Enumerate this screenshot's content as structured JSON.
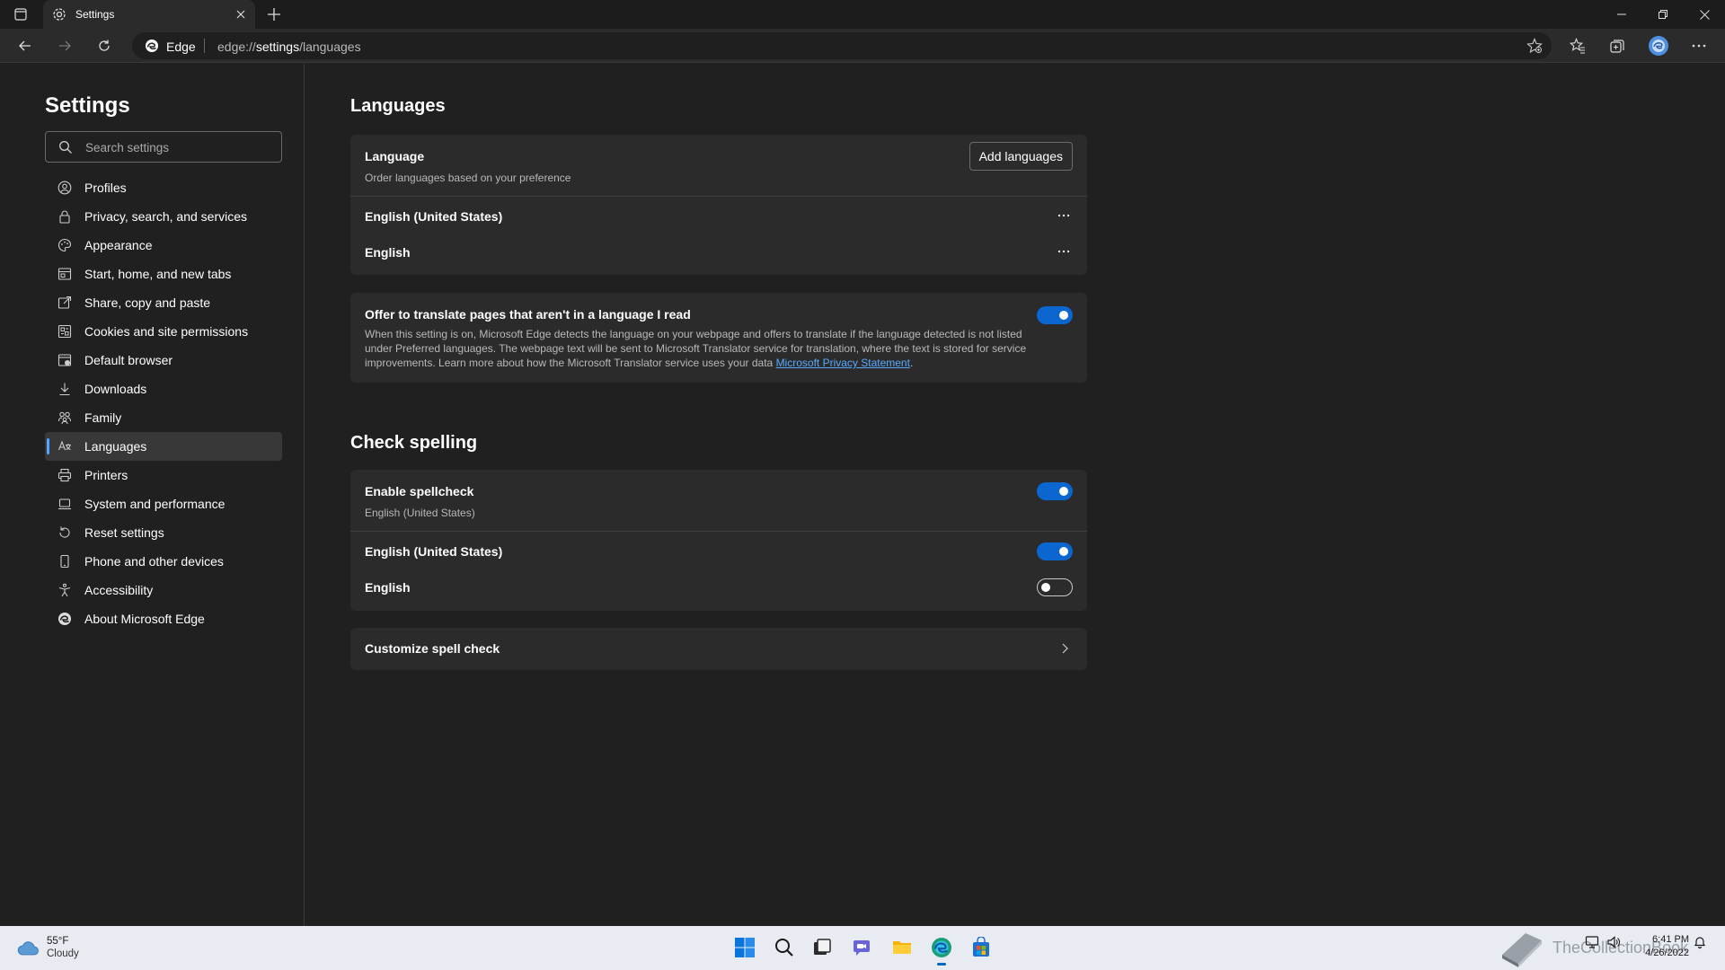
{
  "browser": {
    "tab_title": "Settings",
    "omnibox_label": "Edge",
    "url_prefix": "edge://",
    "url_host": "settings",
    "url_path": "/languages"
  },
  "sidebar": {
    "title": "Settings",
    "search_placeholder": "Search settings",
    "items": [
      {
        "label": "Profiles",
        "icon": "profile-icon"
      },
      {
        "label": "Privacy, search, and services",
        "icon": "lock-icon"
      },
      {
        "label": "Appearance",
        "icon": "appearance-icon"
      },
      {
        "label": "Start, home, and new tabs",
        "icon": "home-tabs-icon"
      },
      {
        "label": "Share, copy and paste",
        "icon": "share-icon"
      },
      {
        "label": "Cookies and site permissions",
        "icon": "cookies-icon"
      },
      {
        "label": "Default browser",
        "icon": "default-browser-icon"
      },
      {
        "label": "Downloads",
        "icon": "download-icon"
      },
      {
        "label": "Family",
        "icon": "family-icon"
      },
      {
        "label": "Languages",
        "icon": "languages-icon",
        "active": true
      },
      {
        "label": "Printers",
        "icon": "printer-icon"
      },
      {
        "label": "System and performance",
        "icon": "laptop-icon"
      },
      {
        "label": "Reset settings",
        "icon": "reset-icon"
      },
      {
        "label": "Phone and other devices",
        "icon": "phone-icon"
      },
      {
        "label": "Accessibility",
        "icon": "accessibility-icon"
      },
      {
        "label": "About Microsoft Edge",
        "icon": "edge-logo-icon"
      }
    ]
  },
  "languages": {
    "heading": "Languages",
    "language_title": "Language",
    "language_sub": "Order languages based on your preference",
    "add_button": "Add languages",
    "list": [
      "English (United States)",
      "English"
    ],
    "translate_title": "Offer to translate pages that aren't in a language I read",
    "translate_desc": "When this setting is on, Microsoft Edge detects the language on your webpage and offers to translate if the language detected is not listed under Preferred languages. The webpage text will be sent to Microsoft Translator service for translation, where the text is stored for service improvements. Learn more about how the Microsoft Translator service uses your data",
    "translate_link": "Microsoft Privacy Statement",
    "translate_on": true
  },
  "spelling": {
    "heading": "Check spelling",
    "enable_title": "Enable spellcheck",
    "enable_sub": "English (United States)",
    "enable_on": true,
    "langs": [
      {
        "label": "English (United States)",
        "on": true
      },
      {
        "label": "English",
        "on": false
      }
    ],
    "customize": "Customize spell check"
  },
  "taskbar": {
    "temp": "55°F",
    "condition": "Cloudy",
    "time": "6:41 PM",
    "date": "4/26/2022",
    "watermark": "TheCollectionBook"
  },
  "colors": {
    "accent": "#0b66d0",
    "link": "#5aaaff",
    "background": "#202020",
    "card": "#2b2b2b"
  }
}
